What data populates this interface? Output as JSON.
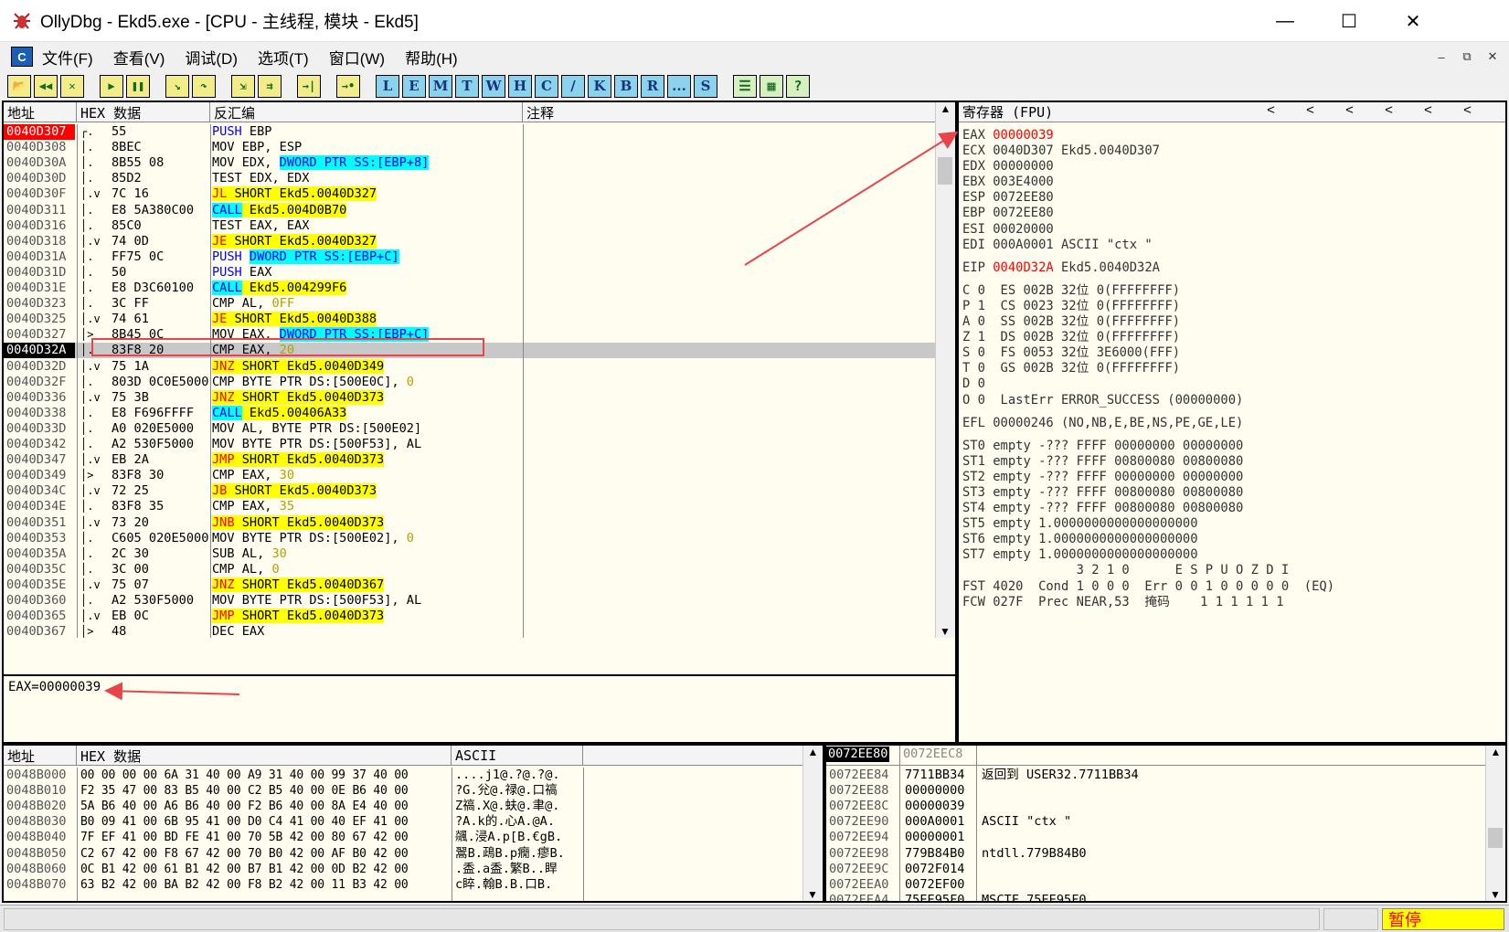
{
  "window": {
    "title": "OllyDbg - Ekd5.exe - [CPU - 主线程, 模块 - Ekd5]",
    "min": "—",
    "max": "☐",
    "close": "✕"
  },
  "menu": {
    "items": [
      "文件(F)",
      "查看(V)",
      "调试(D)",
      "选项(T)",
      "窗口(W)",
      "帮助(H)"
    ],
    "mdi": [
      "–",
      "⧉",
      "✕"
    ]
  },
  "toolbar": {
    "icons": [
      {
        "name": "open-icon",
        "glyph": "📂"
      },
      {
        "name": "restart-icon",
        "glyph": "◀◀"
      },
      {
        "name": "close-program-icon",
        "glyph": "✕"
      },
      {
        "name": "run-icon",
        "glyph": "▶"
      },
      {
        "name": "pause-icon",
        "glyph": "❚❚"
      },
      {
        "name": "step-into-icon",
        "glyph": "↘"
      },
      {
        "name": "step-over-icon",
        "glyph": "↷"
      },
      {
        "name": "trace-into-icon",
        "glyph": "⇲"
      },
      {
        "name": "trace-over-icon",
        "glyph": "⇉"
      },
      {
        "name": "execute-till-return-icon",
        "glyph": "→|"
      },
      {
        "name": "goto-icon",
        "glyph": "→•"
      }
    ],
    "letters": [
      "L",
      "E",
      "M",
      "T",
      "W",
      "H",
      "C",
      "/",
      "K",
      "B",
      "R",
      "...",
      "S"
    ],
    "extra": [
      {
        "name": "list-icon",
        "glyph": "☰"
      },
      {
        "name": "grid-icon",
        "glyph": "▦"
      },
      {
        "name": "help-icon",
        "glyph": "?"
      }
    ]
  },
  "cpu": {
    "headers": {
      "addr": "地址",
      "hex": "HEX 数据",
      "disasm": "反汇编",
      "comment": "注释"
    },
    "rows": [
      {
        "addr": "0040D307",
        "mark": "┌.",
        "hex": "55",
        "asm": [
          [
            "PUSH ",
            "kw-blue"
          ],
          [
            "EBP",
            ""
          ]
        ]
      },
      {
        "addr": "0040D308",
        "mark": "│.",
        "hex": "8BEC",
        "asm": [
          [
            "MOV EBP, ESP",
            ""
          ]
        ]
      },
      {
        "addr": "0040D30A",
        "mark": "│.",
        "hex": "8B55 08",
        "asm": [
          [
            "MOV EDX, ",
            ""
          ],
          [
            "DWORD PTR SS:[EBP+8]",
            "hl-cyan kw-blue"
          ]
        ]
      },
      {
        "addr": "0040D30D",
        "mark": "│.",
        "hex": "85D2",
        "asm": [
          [
            "TEST EDX, EDX",
            ""
          ]
        ]
      },
      {
        "addr": "0040D30F",
        "mark": "│.v",
        "hex": "7C 16",
        "asm": [
          [
            "JL",
            "hl-yellow kw-red"
          ],
          [
            " SHORT Ekd5.0040D327",
            "hl-yellow"
          ]
        ]
      },
      {
        "addr": "0040D311",
        "mark": "│.",
        "hex": "E8 5A380C00",
        "asm": [
          [
            "CALL",
            "hl-cyan kw-blue"
          ],
          [
            " Ekd5.004D0B70",
            "hl-yellow"
          ]
        ]
      },
      {
        "addr": "0040D316",
        "mark": "│.",
        "hex": "85C0",
        "asm": [
          [
            "TEST EAX, EAX",
            ""
          ]
        ]
      },
      {
        "addr": "0040D318",
        "mark": "│.v",
        "hex": "74 0D",
        "asm": [
          [
            "JE",
            "hl-yellow kw-red"
          ],
          [
            " SHORT Ekd5.0040D327",
            "hl-yellow"
          ]
        ]
      },
      {
        "addr": "0040D31A",
        "mark": "│.",
        "hex": "FF75 0C",
        "asm": [
          [
            "PUSH ",
            "kw-blue"
          ],
          [
            "DWORD PTR SS:[EBP+C]",
            "hl-cyan kw-blue"
          ]
        ]
      },
      {
        "addr": "0040D31D",
        "mark": "│.",
        "hex": "50",
        "asm": [
          [
            "PUSH ",
            "kw-blue"
          ],
          [
            "EAX",
            ""
          ]
        ]
      },
      {
        "addr": "0040D31E",
        "mark": "│.",
        "hex": "E8 D3C60100",
        "asm": [
          [
            "CALL",
            "hl-cyan kw-blue"
          ],
          [
            " Ekd5.004299F6",
            "hl-yellow"
          ]
        ]
      },
      {
        "addr": "0040D323",
        "mark": "│.",
        "hex": "3C FF",
        "asm": [
          [
            "CMP AL, ",
            ""
          ],
          [
            "0FF",
            "kw-olive"
          ]
        ]
      },
      {
        "addr": "0040D325",
        "mark": "│.v",
        "hex": "74 61",
        "asm": [
          [
            "JE",
            "hl-yellow kw-red"
          ],
          [
            " SHORT Ekd5.0040D388",
            "hl-yellow"
          ]
        ]
      },
      {
        "addr": "0040D327",
        "mark": "│>",
        "hex": "8B45 0C",
        "asm": [
          [
            "MOV EAX, ",
            ""
          ],
          [
            "DWORD PTR SS:[EBP+C]",
            "hl-cyan kw-blue"
          ]
        ]
      },
      {
        "addr": "0040D32A",
        "mark": "│.",
        "hex": "83F8 20",
        "asm": [
          [
            "CMP EAX, ",
            ""
          ],
          [
            "20",
            "kw-olive"
          ]
        ],
        "current": true
      },
      {
        "addr": "0040D32D",
        "mark": "│.v",
        "hex": "75 1A",
        "asm": [
          [
            "JNZ",
            "hl-yellow kw-red"
          ],
          [
            " SHORT Ekd5.0040D349",
            "hl-yellow"
          ]
        ]
      },
      {
        "addr": "0040D32F",
        "mark": "│.",
        "hex": "803D 0C0E5000",
        "asm": [
          [
            "CMP BYTE PTR DS:[500E0C], ",
            ""
          ],
          [
            "0",
            "kw-olive"
          ]
        ]
      },
      {
        "addr": "0040D336",
        "mark": "│.v",
        "hex": "75 3B",
        "asm": [
          [
            "JNZ",
            "hl-yellow kw-red"
          ],
          [
            " SHORT Ekd5.0040D373",
            "hl-yellow"
          ]
        ]
      },
      {
        "addr": "0040D338",
        "mark": "│.",
        "hex": "E8 F696FFFF",
        "asm": [
          [
            "CALL",
            "hl-cyan kw-blue"
          ],
          [
            " Ekd5.00406A33",
            "hl-yellow"
          ]
        ]
      },
      {
        "addr": "0040D33D",
        "mark": "│.",
        "hex": "A0 020E5000",
        "asm": [
          [
            "MOV AL, BYTE PTR DS:[500E02]",
            ""
          ]
        ]
      },
      {
        "addr": "0040D342",
        "mark": "│.",
        "hex": "A2 530F5000",
        "asm": [
          [
            "MOV BYTE PTR DS:[500F53], AL",
            ""
          ]
        ]
      },
      {
        "addr": "0040D347",
        "mark": "│.v",
        "hex": "EB 2A",
        "asm": [
          [
            "JMP",
            "hl-yellow kw-red"
          ],
          [
            " SHORT Ekd5.0040D373",
            "hl-yellow"
          ]
        ]
      },
      {
        "addr": "0040D349",
        "mark": "│>",
        "hex": "83F8 30",
        "asm": [
          [
            "CMP EAX, ",
            ""
          ],
          [
            "30",
            "kw-olive"
          ]
        ]
      },
      {
        "addr": "0040D34C",
        "mark": "│.v",
        "hex": "72 25",
        "asm": [
          [
            "JB",
            "hl-yellow kw-red"
          ],
          [
            " SHORT Ekd5.0040D373",
            "hl-yellow"
          ]
        ]
      },
      {
        "addr": "0040D34E",
        "mark": "│.",
        "hex": "83F8 35",
        "asm": [
          [
            "CMP EAX, ",
            ""
          ],
          [
            "35",
            "kw-olive"
          ]
        ]
      },
      {
        "addr": "0040D351",
        "mark": "│.v",
        "hex": "73 20",
        "asm": [
          [
            "JNB",
            "hl-yellow kw-red"
          ],
          [
            " SHORT Ekd5.0040D373",
            "hl-yellow"
          ]
        ]
      },
      {
        "addr": "0040D353",
        "mark": "│.",
        "hex": "C605 020E5000",
        "asm": [
          [
            "MOV BYTE PTR DS:[500E02], ",
            ""
          ],
          [
            "0",
            "kw-olive"
          ]
        ]
      },
      {
        "addr": "0040D35A",
        "mark": "│.",
        "hex": "2C 30",
        "asm": [
          [
            "SUB AL, ",
            ""
          ],
          [
            "30",
            "kw-olive"
          ]
        ]
      },
      {
        "addr": "0040D35C",
        "mark": "│.",
        "hex": "3C 00",
        "asm": [
          [
            "CMP AL, ",
            ""
          ],
          [
            "0",
            "kw-olive"
          ]
        ]
      },
      {
        "addr": "0040D35E",
        "mark": "│.v",
        "hex": "75 07",
        "asm": [
          [
            "JNZ",
            "hl-yellow kw-red"
          ],
          [
            " SHORT Ekd5.0040D367",
            "hl-yellow"
          ]
        ]
      },
      {
        "addr": "0040D360",
        "mark": "│.",
        "hex": "A2 530F5000",
        "asm": [
          [
            "MOV BYTE PTR DS:[500F53], AL",
            ""
          ]
        ]
      },
      {
        "addr": "0040D365",
        "mark": "│.v",
        "hex": "EB 0C",
        "asm": [
          [
            "JMP",
            "hl-yellow kw-red"
          ],
          [
            " SHORT Ekd5.0040D373",
            "hl-yellow"
          ]
        ]
      },
      {
        "addr": "0040D367",
        "mark": "│>",
        "hex": "48",
        "asm": [
          [
            "DEC EAX",
            ""
          ]
        ]
      }
    ]
  },
  "info": {
    "text": "EAX=00000039"
  },
  "registers": {
    "header": "寄存器 (FPU)",
    "arrows": [
      "<",
      "<",
      "<",
      "<",
      "<",
      "<"
    ],
    "lines": [
      [
        [
          "EAX ",
          ""
        ],
        [
          "00000039",
          "red"
        ]
      ],
      [
        [
          "ECX 0040D307 Ekd5.0040D307",
          ""
        ]
      ],
      [
        [
          "EDX 00000000",
          ""
        ]
      ],
      [
        [
          "EBX 003E4000",
          ""
        ]
      ],
      [
        [
          "ESP 0072EE80",
          ""
        ]
      ],
      [
        [
          "EBP 0072EE80",
          ""
        ]
      ],
      [
        [
          "ESI 00020000",
          ""
        ]
      ],
      [
        [
          "EDI 000A0001 ASCII \"ctx \"",
          ""
        ]
      ],
      [
        [
          "",
          ""
        ]
      ],
      [
        [
          "EIP ",
          ""
        ],
        [
          "0040D32A",
          "red"
        ],
        [
          " Ekd5.0040D32A",
          ""
        ]
      ],
      [
        [
          "",
          ""
        ]
      ],
      [
        [
          "C 0  ES 002B 32位 0(FFFFFFFF)",
          ""
        ]
      ],
      [
        [
          "P 1  CS 0023 32位 0(FFFFFFFF)",
          ""
        ]
      ],
      [
        [
          "A 0  SS 002B 32位 0(FFFFFFFF)",
          ""
        ]
      ],
      [
        [
          "Z 1  DS 002B 32位 0(FFFFFFFF)",
          ""
        ]
      ],
      [
        [
          "S 0  FS 0053 32位 3E6000(FFF)",
          ""
        ]
      ],
      [
        [
          "T 0  GS 002B 32位 0(FFFFFFFF)",
          ""
        ]
      ],
      [
        [
          "D 0",
          ""
        ]
      ],
      [
        [
          "O 0  LastErr ERROR_SUCCESS (00000000)",
          ""
        ]
      ],
      [
        [
          "",
          ""
        ]
      ],
      [
        [
          "EFL 00000246 (NO,NB,E,BE,NS,PE,GE,LE)",
          ""
        ]
      ],
      [
        [
          "",
          ""
        ]
      ],
      [
        [
          "ST0 empty -??? FFFF 00000000 00000000",
          ""
        ]
      ],
      [
        [
          "ST1 empty -??? FFFF 00800080 00800080",
          ""
        ]
      ],
      [
        [
          "ST2 empty -??? FFFF 00000000 00000000",
          ""
        ]
      ],
      [
        [
          "ST3 empty -??? FFFF 00800080 00800080",
          ""
        ]
      ],
      [
        [
          "ST4 empty -??? FFFF 00800080 00800080",
          ""
        ]
      ],
      [
        [
          "ST5 empty 1.0000000000000000000",
          ""
        ]
      ],
      [
        [
          "ST6 empty 1.0000000000000000000",
          ""
        ]
      ],
      [
        [
          "ST7 empty 1.0000000000000000000",
          ""
        ]
      ],
      [
        [
          "               3 2 1 0      E S P U O Z D I",
          ""
        ]
      ],
      [
        [
          "FST 4020  Cond 1 0 0 0  Err 0 0 1 0 0 0 0 0  (EQ)",
          ""
        ]
      ],
      [
        [
          "FCW 027F  Prec NEAR,53  掩码    1 1 1 1 1 1",
          ""
        ]
      ]
    ]
  },
  "dump": {
    "headers": {
      "addr": "地址",
      "hex": "HEX 数据",
      "ascii": "ASCII"
    },
    "rows": [
      {
        "addr": "0048B000",
        "hex": "00 00 00 00 6A 31 40 00 A9 31 40 00 99 37 40 00",
        "ascii": "....j1@.?@.?@."
      },
      {
        "addr": "0048B010",
        "hex": "F2 35 47 00 83 B5 40 00 C2 B5 40 00 0E B6 40 00",
        "ascii": "?G.兊@.禄@.口禞"
      },
      {
        "addr": "0048B020",
        "hex": "5A B6 40 00 A6 B6 40 00 F2 B6 40 00 8A E4 40 00",
        "ascii": "Z禞.X@.蚨@.聿@."
      },
      {
        "addr": "0048B030",
        "hex": "B0 09 41 00 6B 95 41 00 D0 C4 41 00 40 EF 41 00",
        "ascii": "?A.k的.心A.@A."
      },
      {
        "addr": "0048B040",
        "hex": "7F EF 41 00 BD FE 41 00 70 5B 42 00 80 67 42 00",
        "ascii": "飊.浸A.p[B.€gB."
      },
      {
        "addr": "0048B050",
        "hex": "C2 67 42 00 F8 67 42 00 70 B0 42 00 AF B0 42 00",
        "ascii": "翯B.鴊B.p癇.瘳B."
      },
      {
        "addr": "0048B060",
        "hex": "0C B1 42 00 61 B1 42 00 B7 B1 42 00 0D B2 42 00",
        "ascii": ".盉.a盉.繁B..睅"
      },
      {
        "addr": "0048B070",
        "hex": "63 B2 42 00 BA B2 42 00 F8 B2 42 00 11 B3 42 00",
        "ascii": "c睟.翰B.B.口B."
      }
    ]
  },
  "stack": {
    "top": [
      "0072EE80",
      "0072EEC8"
    ],
    "rows": [
      {
        "addr": "0072EE84",
        "val": "7711BB34",
        "comment": "返回到 USER32.7711BB34"
      },
      {
        "addr": "0072EE88",
        "val": "00000000",
        "comment": ""
      },
      {
        "addr": "0072EE8C",
        "val": "00000039",
        "comment": ""
      },
      {
        "addr": "0072EE90",
        "val": "000A0001",
        "comment": "ASCII \"ctx \""
      },
      {
        "addr": "0072EE94",
        "val": "00000001",
        "comment": ""
      },
      {
        "addr": "0072EE98",
        "val": "779B84B0",
        "comment": "ntdll.779B84B0"
      },
      {
        "addr": "0072EE9C",
        "val": "0072F014",
        "comment": ""
      },
      {
        "addr": "0072EEA0",
        "val": "0072EF00",
        "comment": ""
      },
      {
        "addr": "0072EEA4",
        "val": "75EE95F0",
        "comment": "MSCTF.75EE95F0"
      }
    ]
  },
  "status": {
    "state": "暂停"
  },
  "colors": {
    "accent_red": "#ff0000",
    "highlight_yellow": "#ffff00",
    "highlight_cyan": "#00ffff",
    "pane_bg": "#fffdf0"
  }
}
